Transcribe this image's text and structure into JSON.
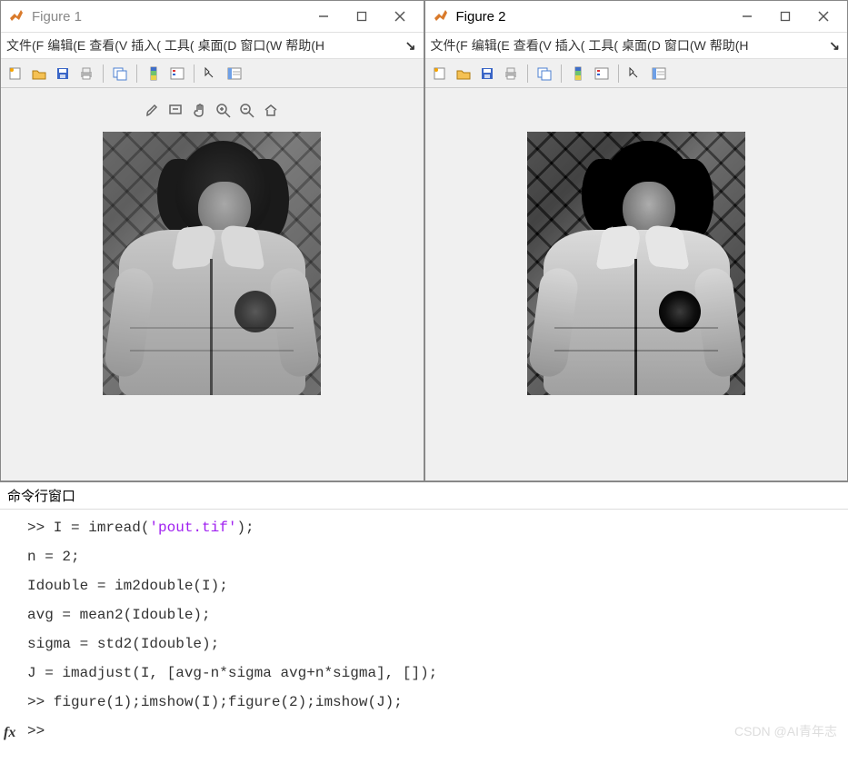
{
  "figure1": {
    "title": "Figure 1",
    "menus": [
      "文件(F",
      "编辑(E",
      "查看(V",
      "插入(",
      "工具(",
      "桌面(D",
      "窗口(W",
      "帮助(H"
    ]
  },
  "figure2": {
    "title": "Figure 2",
    "menus": [
      "文件(F",
      "编辑(E",
      "查看(V",
      "插入(",
      "工具(",
      "桌面(D",
      "窗口(W",
      "帮助(H"
    ]
  },
  "command": {
    "title": "命令行窗口",
    "prompt": ">>",
    "lines": {
      "l1a": ">> I = imread(",
      "l1b": "'pout.tif'",
      "l1c": ");",
      "l2": "n = 2;",
      "l3": "Idouble = im2double(I);",
      "l4": "avg = mean2(Idouble);",
      "l5": "sigma = std2(Idouble);",
      "l6": "J = imadjust(I, [avg-n*sigma avg+n*sigma], []);",
      "l7": ">> figure(1);imshow(I);figure(2);imshow(J);",
      "l8": ">>"
    }
  },
  "watermark": "CSDN @AI青年志"
}
